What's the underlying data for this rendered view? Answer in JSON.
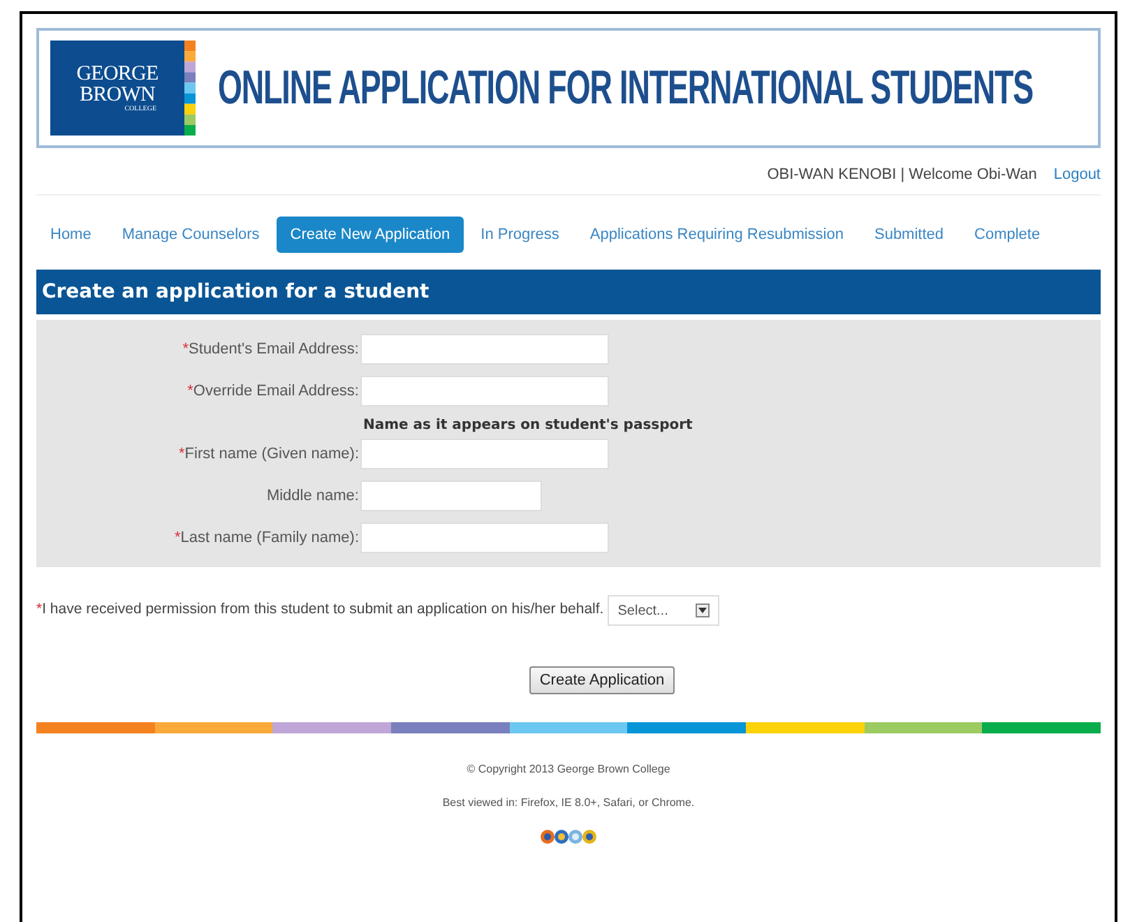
{
  "header": {
    "logo_lines": [
      "GEORGE",
      "BROWN",
      "COLLEGE"
    ],
    "title": "ONLINE APPLICATION FOR INTERNATIONAL STUDENTS"
  },
  "user_bar": {
    "welcome": "OBI-WAN KENOBI | Welcome Obi-Wan",
    "logout": "Logout"
  },
  "nav": [
    {
      "label": "Home",
      "selected": false
    },
    {
      "label": "Manage Counselors",
      "selected": false
    },
    {
      "label": "Create New Application",
      "selected": true
    },
    {
      "label": "In Progress",
      "selected": false
    },
    {
      "label": "Applications Requiring Resubmission",
      "selected": false
    },
    {
      "label": "Submitted",
      "selected": false
    },
    {
      "label": "Complete",
      "selected": false
    }
  ],
  "form": {
    "title": "Create an application for a student",
    "fields": [
      {
        "kind": "input",
        "marker": "*",
        "label": "Student's Email Address:"
      },
      {
        "kind": "input",
        "marker": "*",
        "label": "Override Email Address:"
      },
      {
        "kind": "note",
        "label": "Name as it appears on student's passport"
      },
      {
        "kind": "input",
        "marker": "*",
        "label": "First name (Given name):"
      },
      {
        "kind": "short",
        "label": "Middle name:"
      },
      {
        "kind": "input",
        "marker": "*",
        "label": "Last name (Family name):"
      }
    ],
    "permission": {
      "marker": "*",
      "label": "I have received permission from this student to submit an application on his/her behalf.",
      "select": "Select..."
    },
    "submit": "Create Application"
  },
  "footer": {
    "copyright": "© Copyright 2013 George Brown College",
    "browsers": "Best viewed in: Firefox, IE 8.0+, Safari, or Chrome."
  }
}
